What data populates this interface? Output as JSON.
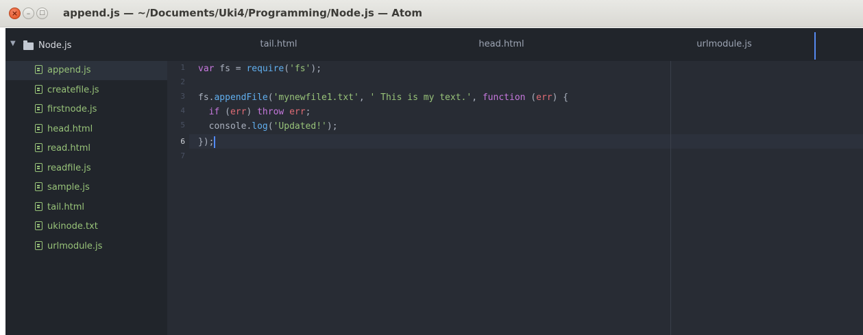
{
  "window": {
    "title": "append.js — ~/Documents/Uki4/Programming/Node.js — Atom"
  },
  "tree": {
    "root_label": "Node.js",
    "files": [
      "append.js",
      "createfile.js",
      "firstnode.js",
      "head.html",
      "read.html",
      "readfile.js",
      "sample.js",
      "tail.html",
      "ukinode.txt",
      "urlmodule.js"
    ],
    "selected": "append.js"
  },
  "tabs": [
    "tail.html",
    "head.html",
    "urlmodule.js"
  ],
  "editor": {
    "line_numbers": [
      "1",
      "2",
      "3",
      "4",
      "5",
      "6",
      "7"
    ],
    "active_line": "6",
    "code": {
      "l1_kw": "var",
      "l1_a": " fs = ",
      "l1_fn": "require",
      "l1_b": "(",
      "l1_str": "'fs'",
      "l1_c": ");",
      "l3_a": "fs.",
      "l3_fn": "appendFile",
      "l3_b": "(",
      "l3_str1": "'mynewfile1.txt'",
      "l3_c": ", ",
      "l3_str2": "' This is my text.'",
      "l3_d": ", ",
      "l3_kw": "function",
      "l3_e": " (",
      "l3_var": "err",
      "l3_f": ") {",
      "l4_indent": "  ",
      "l4_kw": "if",
      "l4_a": " (",
      "l4_var": "err",
      "l4_b": ") ",
      "l4_kw2": "throw",
      "l4_c": " ",
      "l4_var2": "err",
      "l4_d": ";",
      "l5_indent": "  ",
      "l5_a": "console.",
      "l5_fn": "log",
      "l5_b": "(",
      "l5_str": "'Updated!'",
      "l5_c": ");",
      "l6": "});"
    }
  },
  "colors": {
    "accent": "#568af2",
    "file_green": "#98c379",
    "keyword": "#c678dd",
    "function": "#61afef",
    "variable": "#e06c75"
  }
}
